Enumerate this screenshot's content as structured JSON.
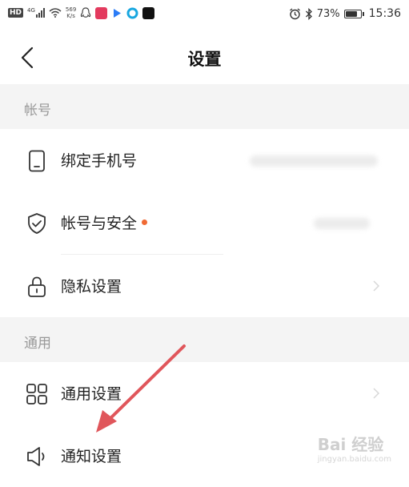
{
  "status_bar": {
    "hd_badge": "HD",
    "signal_label": "4G",
    "net_speed_value": "569",
    "net_speed_unit": "K/s",
    "battery_percent": "73%",
    "battery_level": 0.73,
    "time": "15:36"
  },
  "nav": {
    "title": "设置"
  },
  "sections": {
    "account": {
      "header": "帐号"
    },
    "general": {
      "header": "通用"
    }
  },
  "rows": {
    "bind_phone": {
      "label": "绑定手机号"
    },
    "account_security": {
      "label": "帐号与安全",
      "accent_color": "#f06a34"
    },
    "privacy": {
      "label": "隐私设置"
    },
    "general_settings": {
      "label": "通用设置"
    },
    "notification": {
      "label": "通知设置"
    }
  },
  "annotation": {
    "arrow_color": "#e0565b"
  },
  "watermark": {
    "brand": "Bai 经验",
    "sub": "jingyan.baidu.com"
  }
}
